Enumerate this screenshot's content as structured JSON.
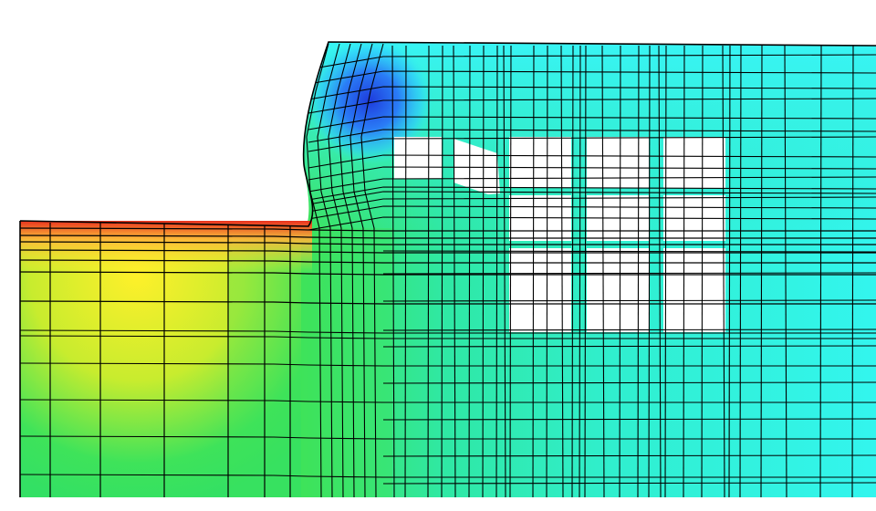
{
  "figure": {
    "kind": "finite-element mesh contour plot",
    "background_color": "#ffffff",
    "mesh_line_color": "#000000",
    "colormap": [
      "#1e3cdc",
      "#2a9cff",
      "#33f5ee",
      "#2ff0c8",
      "#38e35a",
      "#b4ec2e",
      "#fff02a",
      "#ffb43a",
      "#e8321e"
    ],
    "openings": {
      "row_1_count": 5,
      "row_2_count": 3,
      "row_3_count": 3
    }
  }
}
